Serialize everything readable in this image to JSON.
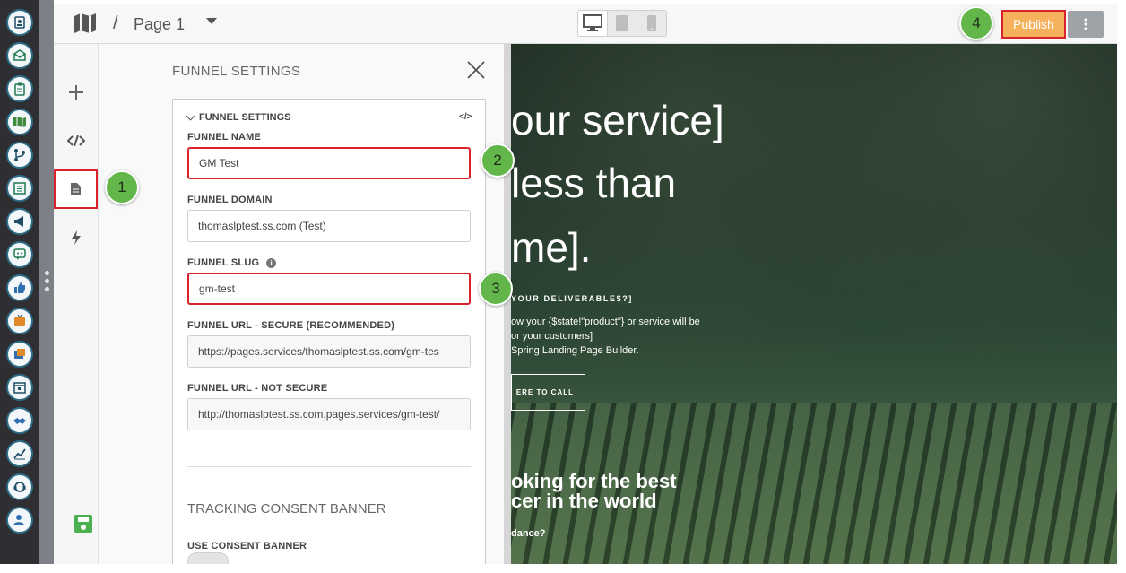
{
  "topbar": {
    "separator": "/",
    "page_name": "Page 1",
    "publish_label": "Publish"
  },
  "panel": {
    "title": "FUNNEL SETTINGS",
    "group_title": "FUNNEL SETTINGS",
    "code_glyph": "</>",
    "fields": {
      "name": {
        "label": "FUNNEL NAME",
        "value": "GM Test"
      },
      "domain": {
        "label": "FUNNEL DOMAIN",
        "value": "thomaslptest.ss.com (Test)"
      },
      "slug": {
        "label": "FUNNEL SLUG",
        "value": "gm-test"
      },
      "url_secure": {
        "label": "FUNNEL URL - SECURE (RECOMMENDED)",
        "value": "https://pages.services/thomaslptest.ss.com/gm-tes"
      },
      "url_insecure": {
        "label": "FUNNEL URL - NOT SECURE",
        "value": "http://thomaslptest.ss.com.pages.services/gm-test/"
      }
    },
    "tracking_title": "TRACKING CONSENT BANNER",
    "consent_label": "USE CONSENT BANNER"
  },
  "preview": {
    "hero": [
      "our service]",
      "less than",
      "me]."
    ],
    "sub": "YOUR DELIVERABLE$?]",
    "desc": [
      "ow your {$state!\"product\"} or service will be",
      "or your customers]",
      "Spring Landing Page Builder."
    ],
    "cta": "ERE TO CALL",
    "h2": [
      "oking for the best",
      "cer in the world"
    ],
    "small": "dance?"
  },
  "callouts": [
    "1",
    "2",
    "3",
    "4"
  ],
  "colors": {
    "highlight": "#d9232a",
    "publish": "#f6b15d",
    "callout": "#63b64a",
    "rail": "#2e2e33",
    "save": "#4caf50"
  },
  "icons": {
    "rail": [
      "contacts-icon",
      "email-icon",
      "clipboard-icon",
      "map-icon",
      "branch-icon",
      "list-icon",
      "megaphone-icon",
      "chat-icon",
      "thumbs-up-icon",
      "tv-icon",
      "gallery-icon",
      "calendar-icon",
      "handshake-icon",
      "chart-icon",
      "support-icon",
      "user-settings-icon"
    ]
  }
}
